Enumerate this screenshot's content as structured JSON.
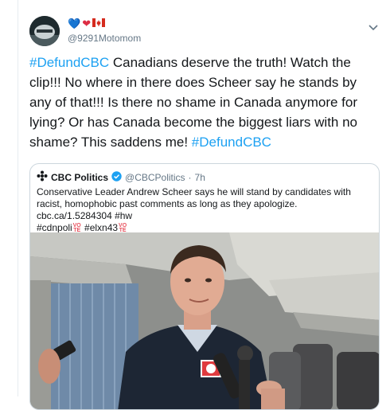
{
  "tweet": {
    "emojis": [
      "💙",
      "❤",
      "🇨🇦"
    ],
    "handle": "@9291Motomom",
    "text_parts": [
      {
        "t": "#DefundCBC",
        "hashtag": true
      },
      {
        "t": " Canadians deserve the truth! Watch the clip!!! No where in there does Scheer say he stands by any of that!!! Is there no shame in Canada anymore for lying? Or has Canada become the biggest liars with no shame? This saddens me! ",
        "hashtag": false
      },
      {
        "t": "#DefundCBC",
        "hashtag": true
      }
    ]
  },
  "quoted": {
    "name": "CBC Politics",
    "handle": "@CBCPolitics",
    "dot": "·",
    "time": "7h",
    "text": "Conservative Leader Andrew Scheer says he will stand by candidates with racist, homophobic past comments as long as they apologize. cbc.ca/1.5284304 #hw",
    "tags": [
      "#cdnpoli",
      "#elxn43"
    ],
    "vote_label": [
      "VO",
      "TE"
    ]
  },
  "colors": {
    "link": "#1da1f2",
    "verified": "#1da1f2",
    "secondary_text": "#657786",
    "border": "#ccd6dd"
  },
  "icons": [
    "avatar",
    "chevron-down-icon",
    "verified-badge-icon",
    "cbc-logo-icon",
    "vote-emoji-icon"
  ]
}
